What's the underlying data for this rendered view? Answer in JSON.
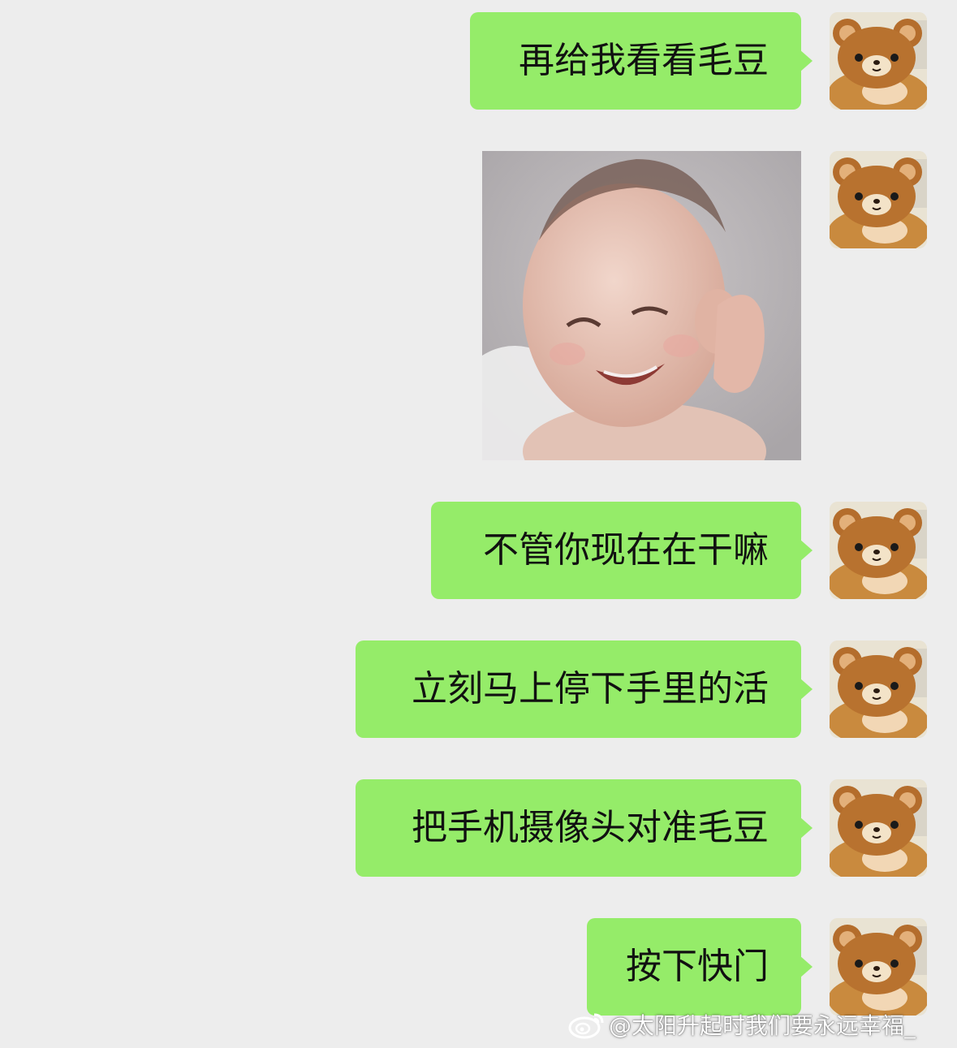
{
  "colors": {
    "background": "#ededed",
    "bubble_green": "#95ec69",
    "text": "#111111"
  },
  "messages": [
    {
      "type": "text",
      "text": "再给我看看毛豆",
      "sender": "me"
    },
    {
      "type": "image",
      "image": "laughing-baby-photo",
      "sender": "me"
    },
    {
      "type": "text",
      "text": "不管你现在在干嘛",
      "sender": "me"
    },
    {
      "type": "text",
      "text": "立刻马上停下手里的活",
      "sender": "me"
    },
    {
      "type": "text",
      "text": "把手机摄像头对准毛豆",
      "sender": "me"
    },
    {
      "type": "text",
      "text": "按下快门",
      "sender": "me"
    }
  ],
  "avatar_icon": "brown-bear-plush-avatar",
  "watermark": {
    "icon": "weibo-logo-icon",
    "text": "@太阳升起时我们要永远幸福_"
  }
}
